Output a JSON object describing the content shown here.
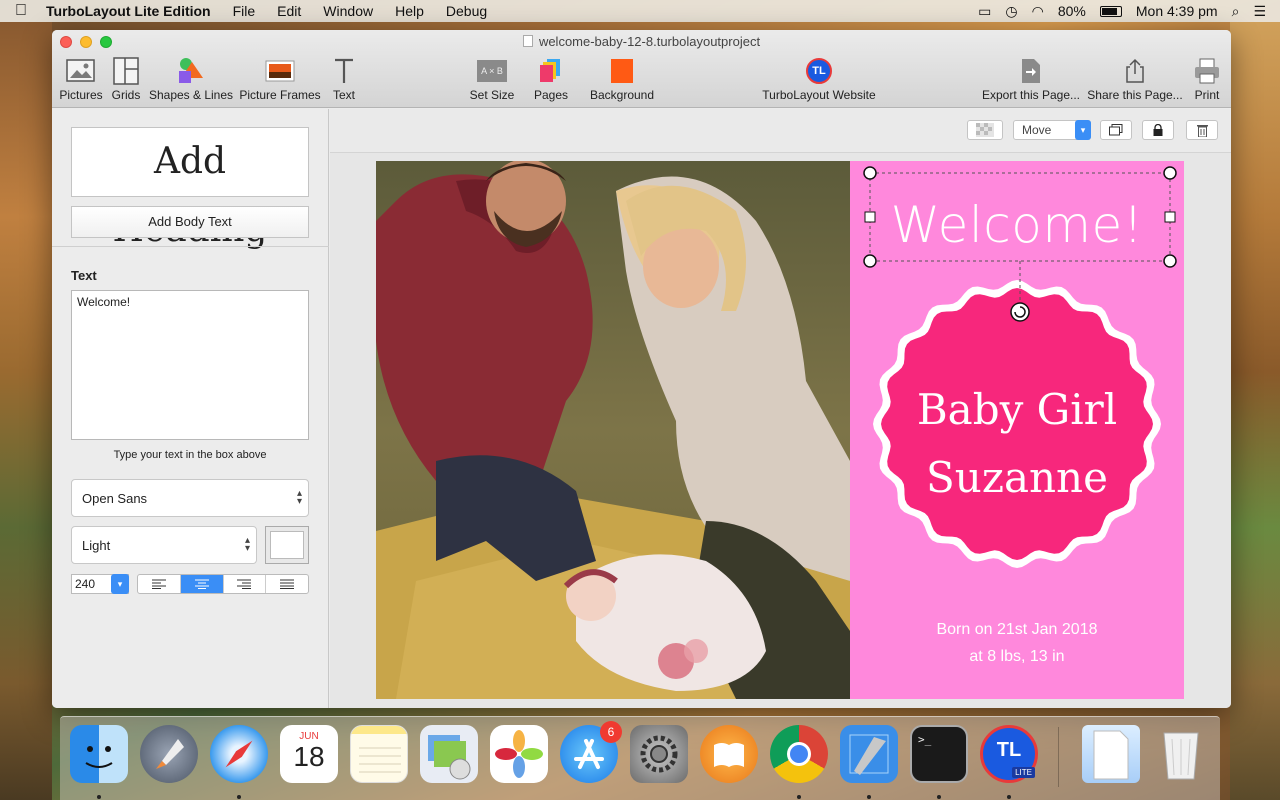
{
  "menubar": {
    "app_name": "TurboLayout Lite Edition",
    "menus": [
      "File",
      "Edit",
      "Window",
      "Help",
      "Debug"
    ],
    "battery": "80%",
    "clock": "Mon 4:39 pm"
  },
  "window": {
    "title": "welcome-baby-12-8.turbolayoutproject"
  },
  "toolbar": {
    "pictures": "Pictures",
    "grids": "Grids",
    "shapes": "Shapes & Lines",
    "frames": "Picture Frames",
    "text": "Text",
    "set_size": "Set Size",
    "set_size_icon_text": "A × B",
    "pages": "Pages",
    "background": "Background",
    "website": "TurboLayout Website",
    "website_icon_text": "TL",
    "export": "Export this Page...",
    "share": "Share this Page...",
    "print": "Print"
  },
  "sidebar": {
    "add_heading": "Add Heading",
    "add_body": "Add Body Text",
    "text_label": "Text",
    "text_value": "Welcome!",
    "hint": "Type your text in the box above",
    "font": "Open Sans",
    "weight": "Light",
    "size": "240",
    "active_alignment": "center"
  },
  "canvas_toolbar": {
    "move": "Move"
  },
  "page": {
    "welcome": "Welcome!",
    "baby_line1": "Baby Girl",
    "baby_line2": "Suzanne",
    "born_line1": "Born on 21st Jan 2018",
    "born_line2": "at 8 lbs, 13 in",
    "accent_color": "#ff88dc",
    "badge_color": "#f7277c"
  },
  "dock": {
    "calendar_month": "JUN",
    "calendar_day": "18",
    "appstore_badge": "6",
    "tl_icon_text": "TL",
    "tl_lite": "LITE"
  }
}
